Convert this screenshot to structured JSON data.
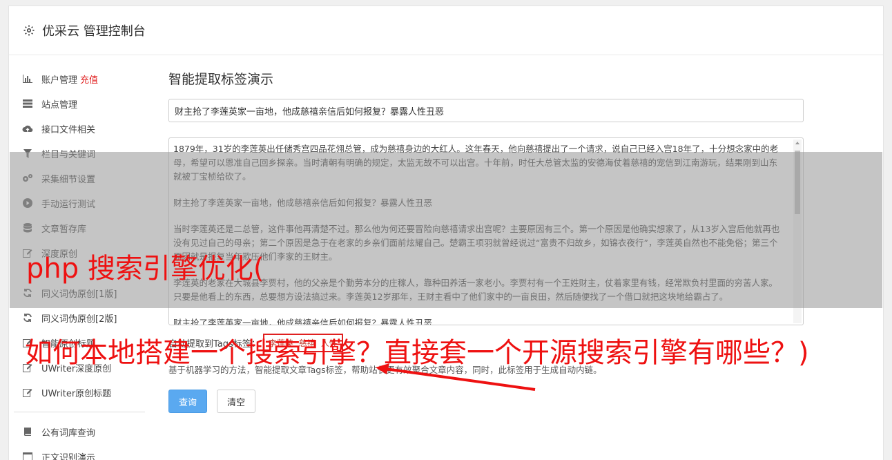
{
  "header": {
    "title": "优采云 管理控制台",
    "icon": "gear-icon"
  },
  "sidebar": {
    "items": [
      {
        "label": "账户管理",
        "badge": "充值",
        "icon": "bar-chart-icon"
      },
      {
        "label": "站点管理",
        "icon": "server-icon"
      },
      {
        "label": "接口文件相关",
        "icon": "cloud-upload-icon"
      },
      {
        "label": "栏目与关键词",
        "icon": "filter-icon"
      },
      {
        "label": "采集细节设置",
        "icon": "cogs-icon"
      },
      {
        "label": "手动运行测试",
        "icon": "play-icon"
      },
      {
        "label": "文章暂存库",
        "icon": "database-icon"
      },
      {
        "label": "深度原创",
        "icon": "edit-icon"
      },
      {
        "label": "同义词伪原创[1版]",
        "icon": "refresh-icon"
      },
      {
        "label": "同义词伪原创[2版]",
        "icon": "refresh-icon"
      },
      {
        "label": "智能原创标题",
        "icon": "edit-icon"
      },
      {
        "label": "UWriter深度原创",
        "icon": "edit-icon"
      },
      {
        "label": "UWriter原创标题",
        "icon": "edit-icon"
      }
    ],
    "items2": [
      {
        "label": "公有词库查询",
        "icon": "book-icon"
      },
      {
        "label": "正文识别演示",
        "icon": "window-icon"
      }
    ]
  },
  "main": {
    "heading": "智能提取标签演示",
    "title_value": "财主抢了李莲英家一亩地，他成慈禧亲信后如何报复？暴露人性丑恶",
    "paragraphs": [
      "1879年，31岁的李莲英出任储秀宫四品花翎总管，成为慈禧身边的大红人。这年春天，他向慈禧提出了一个请求，说自己已经入宫18年了，十分想念家中的老母，希望可以恩准自己回乡探亲。当时清朝有明确的规定，太监无故不可以出宫。十年前，时任大总管太监的安德海仗着慈禧的宠信到江南游玩，结果刚到山东就被丁宝桢给砍了。",
      "财主抢了李莲英家一亩地，他成慈禧亲信后如何报复？暴露人性丑恶",
      "当时李莲英还是二总管，这件事他再清楚不过。那么他为何还要冒险向慈禧请求出宫呢？主要原因有三个。第一个原因是他确实想家了，从13岁入宫后他就再也没有见过自己的母亲；第二个原因是急于在老家的乡亲们面前炫耀自己。楚霸王项羽就曾经说过“富贵不归故乡，如锦衣夜行”，李莲英自然也不能免俗；第三个原因就是报复当年欺压他们李家的王财主。",
      "李莲英的老家在大城县李贾村，他的父亲是个勤劳本分的庄稼人，靠种田养活一家老小。李贾村有一个王姓财主，仗着家里有钱，经常欺负村里面的穷苦人家。只要是他看上的东西，总要想方设法搞过来。李莲英12岁那年，王财主看中了他们家中的一亩良田，然后随便找了一个借口就把这块地给霸占了。",
      "财主抢了李莲英家一亩地，他成慈禧亲信后如何报复？暴露人性丑恶"
    ],
    "tags_label": "自动提取到Tags标签：",
    "tags": [
      "李莲英",
      "慈禧",
      "人性"
    ],
    "description": "基于机器学习的方法，智能提取文章Tags标签，帮助站长更有效聚合文章内容，同时，此标签用于生成自动内链。",
    "query_button": "查询",
    "clear_button": "清空"
  },
  "overlay": {
    "line1": "php 搜索引擎优化(",
    "line2": "如何本地搭建一个搜索引擎？直接套一个开源搜索引擎有哪些？)",
    "color": "#ee1111"
  }
}
